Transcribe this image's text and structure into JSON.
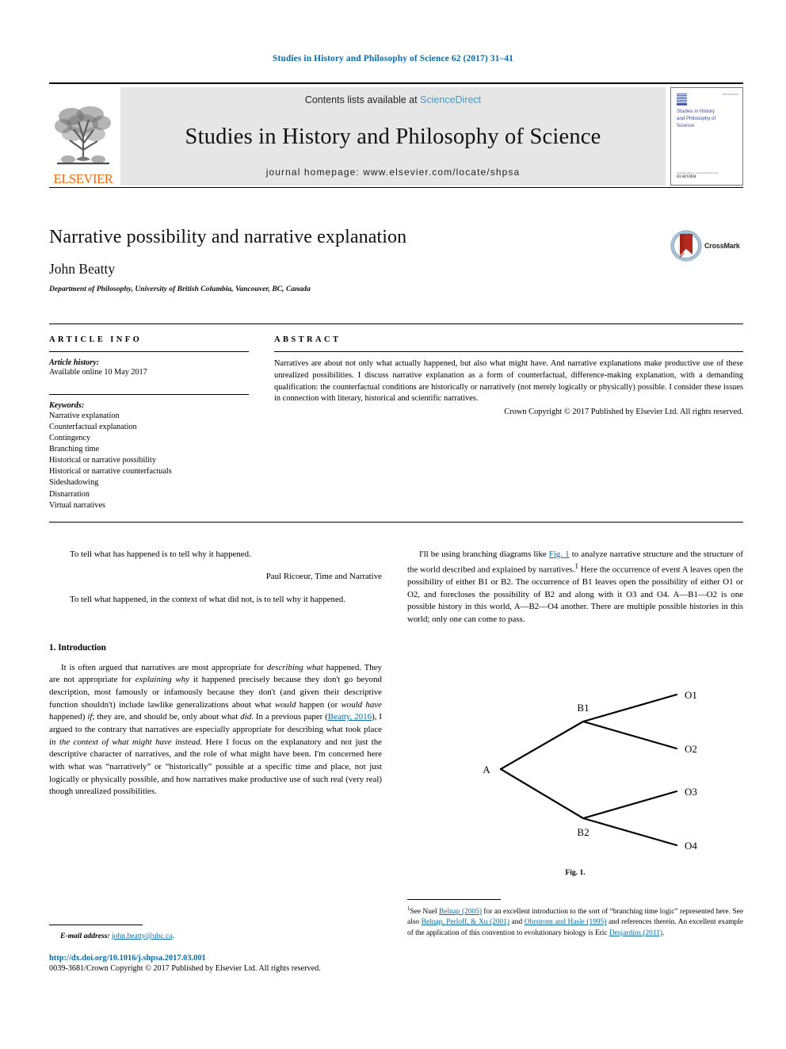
{
  "running_head": "Studies in History and Philosophy of Science 62 (2017) 31–41",
  "masthead": {
    "publisher_wordmark": "ELSEVIER",
    "contents_prefix": "Contents lists available at ",
    "contents_link": "ScienceDirect",
    "journal_title": "Studies in History and Philosophy of Science",
    "homepage_label": "journal homepage: www.elsevier.com/locate/shpsa",
    "cover": {
      "title": "Studies in History and Philosophy of Science",
      "corner_text": "ISSN 0039-3681",
      "footer_small": "Available online at www.sciencedirect.com",
      "footer_brand": "ELSEVIER"
    }
  },
  "article": {
    "title": "Narrative possibility and narrative explanation",
    "author": "John Beatty",
    "affiliation": "Department of Philosophy, University of British Columbia, Vancouver, BC, Canada",
    "crossmark_label": "CrossMark"
  },
  "article_info": {
    "heading": "ARTICLE INFO",
    "history_label": "Article history:",
    "history_value": "Available online 10 May 2017",
    "keywords_label": "Keywords:",
    "keywords": [
      "Narrative explanation",
      "Counterfactual explanation",
      "Contingency",
      "Branching time",
      "Historical or narrative possibility",
      "Historical or narrative counterfactuals",
      "Sideshadowing",
      "Disnarration",
      "Virtual narratives"
    ]
  },
  "abstract": {
    "heading": "ABSTRACT",
    "text": "Narratives are about not only what actually happened, but also what might have. And narrative explanations make productive use of these unrealized possibilities. I discuss narrative explanation as a form of counterfactual, difference-making explanation, with a demanding qualification: the counterfactual conditions are historically or narratively (not merely logically or physically) possible. I consider these issues in connection with literary, historical and scientific narratives.",
    "copyright": "Crown Copyright © 2017 Published by Elsevier Ltd. All rights reserved."
  },
  "epigraphs": [
    {
      "quote": "To tell what has happened is to tell why it happened.",
      "attribution": "Paul Ricoeur, Time and Narrative"
    },
    {
      "quote": "To tell what happened, in the context of what did not, is to tell why it happened."
    }
  ],
  "sections": {
    "intro_heading": "1. Introduction",
    "intro_paragraph": {
      "p1": "It is often argued that narratives are most appropriate for ",
      "i1": "describing what",
      "p2": " happened. They are not appropriate for ",
      "i2": "explaining why",
      "p3": " it happened precisely because they don't go beyond description, most famously or infamously because they don't (and given their descriptive function shouldn't) include lawlike generalizations about what ",
      "i3": "would",
      "p4": " happen (or ",
      "i4": "would have",
      "p5": " happened) ",
      "i5": "if",
      "p6": "; they are, and should be, only about what ",
      "i6": "did",
      "p7": ". In a previous paper (",
      "link1": "Beatty, 2016",
      "p8": "), I argued to the contrary that narratives are especially appropriate for describing what took place ",
      "i7": "in the context of what might have instead",
      "p9": ". Here I focus on the explanatory and not just the descriptive character of narratives, and the role of what might have been. I'm concerned here with what was “narratively” or “historically” possible at a specific time and place, not just logically or physically possible, and how narratives make productive use of such real (very real) though unrealized possibilities."
    },
    "right_paragraph": {
      "p1": "I'll be using branching diagrams like ",
      "link1": "Fig. 1",
      "p2": " to analyze narrative structure and the structure of the world described and explained by narratives.",
      "sup1": "1",
      "p3": " Here the occurrence of event A leaves open the possibility of either B1 or B2. The occurrence of B1 leaves open the possibility of either O1 or O2, and forecloses the possibility of B2 and along with it O3 and O4. A—B1—O2 is one possible history in this world, A—B2—O4 another. There are multiple possible histories in this world; only one can come to pass."
    }
  },
  "figure": {
    "caption": "Fig. 1.",
    "nodes": {
      "root": "A",
      "b1": "B1",
      "b2": "B2",
      "o1": "O1",
      "o2": "O2",
      "o3": "O3",
      "o4": "O4"
    }
  },
  "footnote": {
    "marker": "1",
    "p1": "See Nuel ",
    "link1": "Belnap (2005)",
    "p2": " for an excellent introduction to the sort of “branching time logic” represented here. See also ",
    "link2": "Belnap, Perloff, & Xu (2001)",
    "p3": " and ",
    "link3": "Ohrstrom and Hasle (1995)",
    "p4": " and references therein. An excellent example of the application of this convention to evolutionary biology is Eric ",
    "link4": "Desjardins (2011)",
    "p5": "."
  },
  "footer": {
    "email_label": "E-mail address:",
    "email_value": "john.beatty@ubc.ca",
    "email_suffix": ".",
    "doi": "http://dx.doi.org/10.1016/j.shpsa.2017.03.001",
    "issn_line": "0039-3681/Crown Copyright © 2017 Published by Elsevier Ltd. All rights reserved."
  },
  "colors": {
    "link": "#0b6ca8",
    "sciencedirect": "#3d9bd0",
    "elsevier_orange": "#f06a0a",
    "band_gray": "#e6e6e6"
  }
}
